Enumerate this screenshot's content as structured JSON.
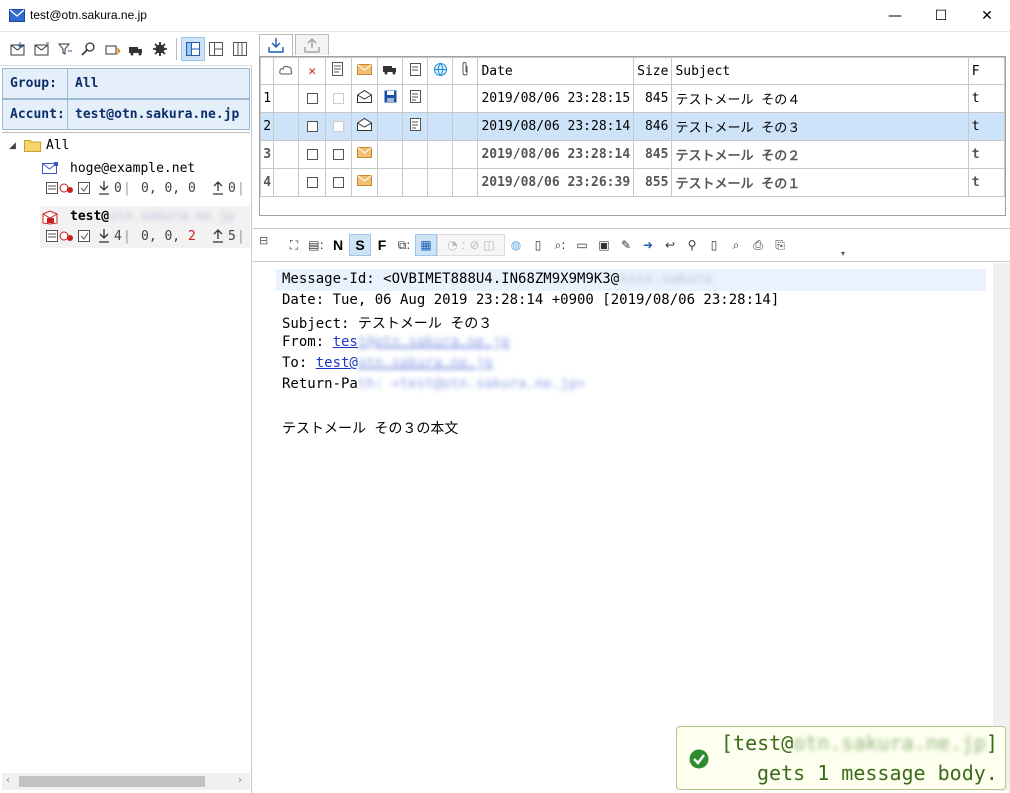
{
  "window": {
    "title": "test@otn.sakura.ne.jp",
    "minimize": "—",
    "maximize": "☐",
    "close": "✕"
  },
  "left": {
    "group_label": "Group:",
    "group_value": "All",
    "account_label": "Accunt:",
    "account_value": "test@otn.sakura.ne.jp",
    "tree": {
      "root": "All",
      "accounts": [
        {
          "name": "hoge@example.net",
          "recv": "0",
          "counts": "0, 0, 0",
          "sent": "0"
        },
        {
          "name_visible": "test@",
          "name_blurred": "otn.sakura.ne.jp",
          "recv": "4",
          "counts_a": "0, 0, ",
          "counts_red": "2",
          "sent": "5"
        }
      ]
    }
  },
  "list": {
    "headers": {
      "date": "Date",
      "size": "Size",
      "subject": "Subject",
      "extra": "F"
    },
    "rows": [
      {
        "n": "1",
        "date": "2019/08/06 23:28:15",
        "size": "845",
        "subject": "テストメール その４",
        "extra": "t"
      },
      {
        "n": "2",
        "date": "2019/08/06 23:28:14",
        "size": "846",
        "subject": "テストメール その３",
        "extra": "t"
      },
      {
        "n": "3",
        "date": "2019/08/06 23:28:14",
        "size": "845",
        "subject": "テストメール その２",
        "extra": "t"
      },
      {
        "n": "4",
        "date": "2019/08/06 23:26:39",
        "size": "855",
        "subject": "テストメール その１",
        "extra": "t"
      }
    ]
  },
  "viewer_toolbar": {
    "n": "N",
    "s": "S",
    "f": "F"
  },
  "message": {
    "message_id_label": "Message-Id: ",
    "message_id_visible": "<OVBIMET888U4.IN68ZM9X9M9K3@",
    "message_id_blurred": "xxxx.sakura",
    "date": "Date: Tue, 06 Aug 2019 23:28:14 +0900 [2019/08/06 23:28:14]",
    "subject": "Subject: テストメール その３",
    "from_label": "From: ",
    "from_visible": "tes",
    "from_blurred": "t@otn.sakura.ne.jp",
    "to_label": "To: ",
    "to_visible": "test@",
    "to_blurred": "otn.sakura.ne.jp",
    "return_label": "Return-Pa",
    "return_blurred": "th: <test@otn.sakura.ne.jp>",
    "body": "テストメール その３の本文"
  },
  "notification": {
    "line1_prefix": "[test@",
    "line1_blurred": "otn.sakura.ne.jp",
    "line1_suffix": "]",
    "line2": "gets 1 message body."
  }
}
